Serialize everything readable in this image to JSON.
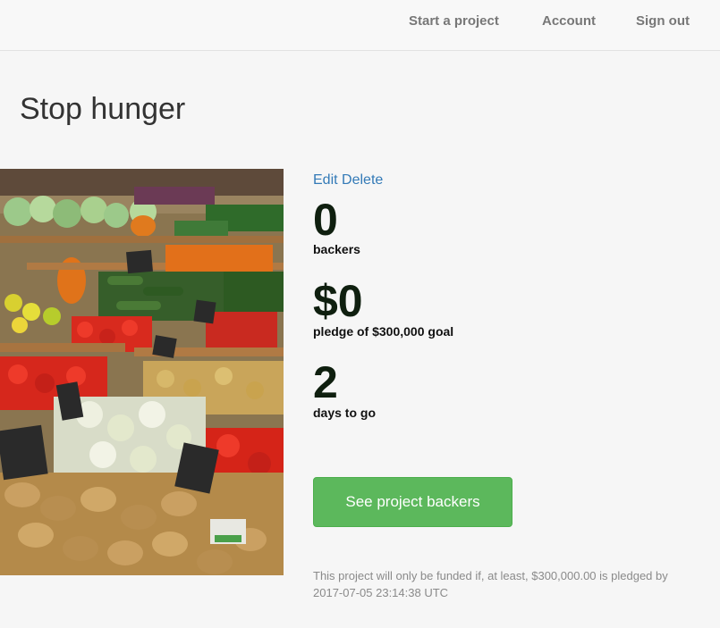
{
  "nav": {
    "start_project": "Start a project",
    "account": "Account",
    "sign_out": "Sign out"
  },
  "project": {
    "title": "Stop hunger",
    "image_alt": "vegetable market stall"
  },
  "actions": {
    "edit": "Edit",
    "delete": "Delete"
  },
  "stats": {
    "backers_value": "0",
    "backers_label": "backers",
    "pledged_value": "$0",
    "pledged_label": "pledge of $300,000 goal",
    "days_value": "2",
    "days_label": "days to go"
  },
  "cta": {
    "see_backers": "See project backers"
  },
  "notice": "This project will only be funded if, at least, $300,000.00 is pledged by 2017-07-05 23:14:38 UTC",
  "colors": {
    "primary_link": "#337ab7",
    "success_button": "#5cb85c",
    "stat_text": "#0f1f0f"
  }
}
